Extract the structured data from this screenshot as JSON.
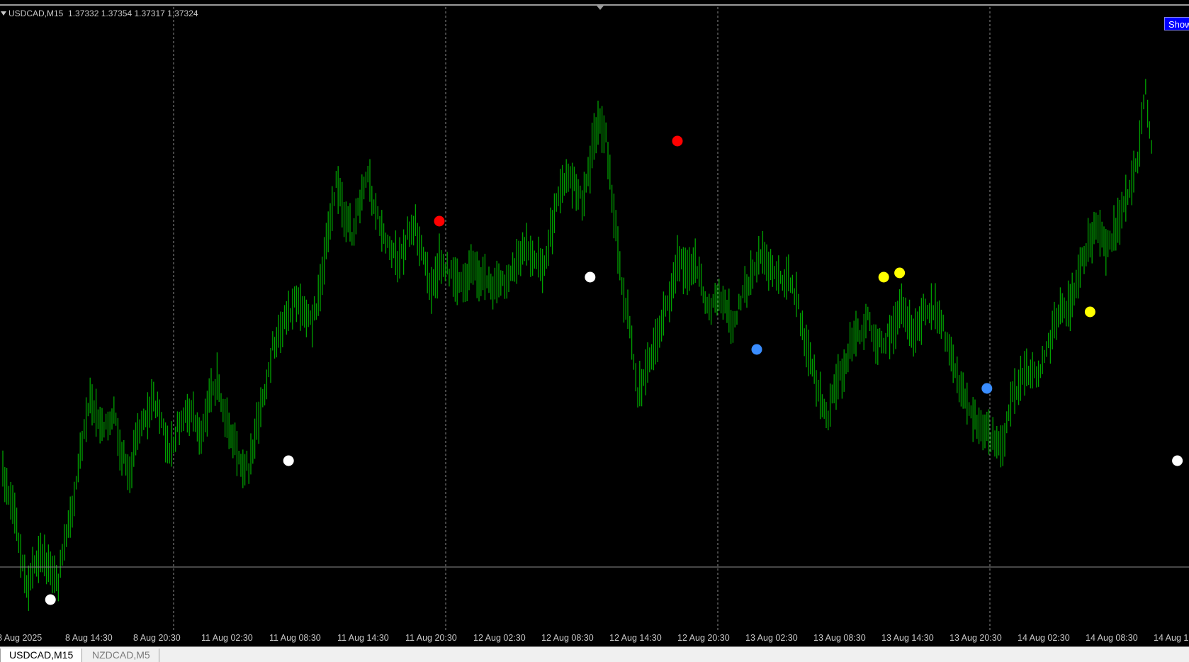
{
  "chart_window": {
    "symbol": "USDCAD,M15",
    "ohlc": "1.37332 1.37354 1.37317 1.37324",
    "show_button_label": "Show",
    "colors": {
      "background": "#000000",
      "candles": "#00a000",
      "grid": "#8c8c8c",
      "price_line": "#8c8c8c",
      "marker_white": "#ffffff",
      "marker_red": "#ff0000",
      "marker_blue": "#3a8dff",
      "marker_yellow": "#ffff00",
      "button": "#0000ff"
    }
  },
  "chart_data": {
    "type": "line",
    "title": "",
    "xlabel": "",
    "ylabel": "",
    "x_tick_labels": [
      "8 Aug 2025",
      "8 Aug 14:30",
      "8 Aug 20:30",
      "11 Aug 02:30",
      "11 Aug 08:30",
      "11 Aug 14:30",
      "11 Aug 20:30",
      "12 Aug 02:30",
      "12 Aug 08:30",
      "12 Aug 14:30",
      "12 Aug 20:30",
      "13 Aug 02:30",
      "13 Aug 08:30",
      "13 Aug 14:30",
      "13 Aug 20:30",
      "14 Aug 02:30",
      "14 Aug 08:30",
      "14 Aug 1"
    ],
    "series": [
      {
        "y": [
          665,
          700,
          760,
          830,
          800,
          780,
          810,
          820,
          760,
          700,
          620,
          560,
          590,
          600,
          580,
          640,
          670,
          610,
          590,
          560,
          600,
          640,
          600,
          580,
          590,
          620,
          560,
          540,
          580,
          620,
          650,
          660,
          600,
          560,
          490,
          470,
          440,
          420,
          440,
          460,
          400,
          330,
          260,
          300,
          330,
          290,
          250,
          300,
          330,
          360,
          370,
          330,
          320,
          360,
          410,
          370,
          380,
          400,
          400,
          380,
          390,
          400,
          410,
          400,
          380,
          370,
          350,
          360,
          380,
          330,
          280,
          250,
          260,
          280,
          230,
          170,
          190,
          300,
          400,
          460,
          560,
          520,
          500,
          450,
          430,
          370,
          380,
          370,
          400,
          440,
          420,
          430,
          460,
          420,
          400,
          370,
          360,
          390,
          400,
          390,
          420,
          480,
          520,
          560,
          590,
          540,
          520,
          480,
          470,
          450,
          490,
          480,
          470,
          430,
          460,
          470,
          440,
          430,
          450,
          480,
          520,
          560,
          580,
          600,
          610,
          620,
          630,
          570,
          540,
          520,
          530,
          510,
          480,
          440,
          440,
          410,
          370,
          340,
          320,
          350,
          330,
          300,
          270,
          220,
          130,
          230
        ],
        "points": [
          {
            "t": "8 Aug 2025",
            "v": 660
          },
          {
            "t": "8 Aug 14:30",
            "v": 580
          },
          {
            "t": "8 Aug 20:30",
            "v": 600
          },
          {
            "t": "11 Aug 02:30",
            "v": 640
          },
          {
            "t": "11 Aug 08:30",
            "v": 430
          },
          {
            "t": "11 Aug 14:30",
            "v": 280
          },
          {
            "t": "11 Aug 20:30",
            "v": 380
          },
          {
            "t": "12 Aug 02:30",
            "v": 400
          },
          {
            "t": "12 Aug 08:30",
            "v": 270
          },
          {
            "t": "12 Aug 14:30",
            "v": 380
          },
          {
            "t": "12 Aug 20:30",
            "v": 400
          },
          {
            "t": "13 Aug 02:30",
            "v": 370
          },
          {
            "t": "13 Aug 08:30",
            "v": 540
          },
          {
            "t": "13 Aug 14:30",
            "v": 470
          },
          {
            "t": "13 Aug 20:30",
            "v": 480
          },
          {
            "t": "14 Aug 02:30",
            "v": 620
          },
          {
            "t": "14 Aug 08:30",
            "v": 450
          },
          {
            "t": "14 Aug 1",
            "v": 140
          }
        ]
      }
    ],
    "price_line_level": 800,
    "markers": [
      {
        "index": 6,
        "level": 846,
        "color": "white"
      },
      {
        "index": 36,
        "level": 650,
        "color": "white"
      },
      {
        "index": 55,
        "level": 312,
        "color": "red"
      },
      {
        "index": 74,
        "level": 391,
        "color": "white"
      },
      {
        "index": 85,
        "level": 199,
        "color": "red"
      },
      {
        "index": 95,
        "level": 493,
        "color": "blue"
      },
      {
        "index": 111,
        "level": 391,
        "color": "yellow"
      },
      {
        "index": 113,
        "level": 385,
        "color": "yellow"
      },
      {
        "index": 124,
        "level": 548,
        "color": "blue"
      },
      {
        "index": 137,
        "level": 440,
        "color": "yellow"
      },
      {
        "index": 148,
        "level": 650,
        "color": "white"
      },
      {
        "index": 154,
        "level": 549,
        "color": "white"
      }
    ]
  },
  "tabs": [
    {
      "label": "USDCAD,M15",
      "active": true
    },
    {
      "label": "NZDCAD,M5",
      "active": false
    }
  ]
}
